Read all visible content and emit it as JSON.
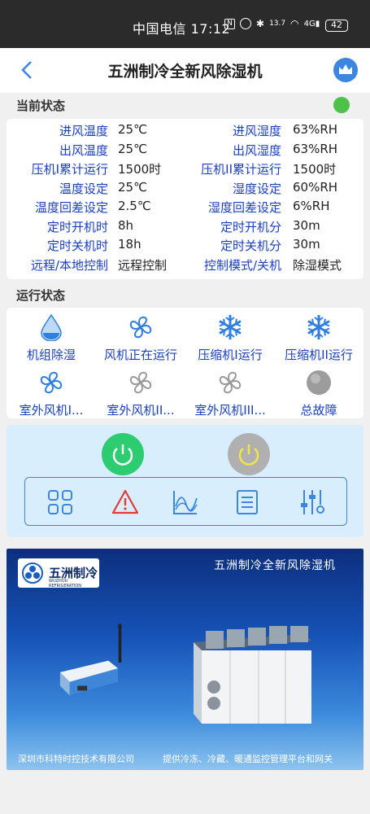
{
  "statusbar": {
    "text": "中国电信 17:12",
    "battery": "42",
    "netspeed": "13.7"
  },
  "header": {
    "title": "五洲制冷全新风除湿机"
  },
  "current_state": {
    "title": "当前状态",
    "rows": [
      {
        "l1": "进风温度",
        "v1": "25℃",
        "l2": "进风湿度",
        "v2": "63%RH"
      },
      {
        "l1": "出风温度",
        "v1": "25℃",
        "l2": "出风湿度",
        "v2": "63%RH"
      },
      {
        "l1": "压机I累计运行",
        "v1": "1500时",
        "l2": "压机II累计运行",
        "v2": "1500时"
      },
      {
        "l1": "温度设定",
        "v1": "25℃",
        "l2": "湿度设定",
        "v2": "60%RH"
      },
      {
        "l1": "温度回差设定",
        "v1": "2.5℃",
        "l2": "湿度回差设定",
        "v2": "6%RH"
      },
      {
        "l1": "定时开机时",
        "v1": "8h",
        "l2": "定时开机分",
        "v2": "30m"
      },
      {
        "l1": "定时关机时",
        "v1": "18h",
        "l2": "定时关机分",
        "v2": "30m"
      },
      {
        "l1": "远程/本地控制",
        "v1": "远程控制",
        "l2": "控制模式/关机",
        "v2": "除湿模式"
      }
    ]
  },
  "run_state": {
    "title": "运行状态",
    "items": [
      {
        "label": "机组除湿",
        "icon": "water-drop-icon"
      },
      {
        "label": "风机正在运行",
        "icon": "fan-icon"
      },
      {
        "label": "压缩机I运行",
        "icon": "snowflake-icon"
      },
      {
        "label": "压缩机II运行",
        "icon": "snowflake-icon"
      },
      {
        "label": "室外风机I...",
        "icon": "fan-icon"
      },
      {
        "label": "室外风机II...",
        "icon": "fan-icon"
      },
      {
        "label": "室外风机III...",
        "icon": "fan-icon"
      },
      {
        "label": "总故障",
        "icon": "fault-indicator-icon"
      }
    ]
  },
  "banner": {
    "logo": "五洲制冷",
    "logo_sub": "WUZHOU REFRIGERATION",
    "title": "五洲制冷全新风除湿机",
    "footer_left": "深圳市科特时控技术有限公司",
    "footer_right": "提供冷冻、冷藏、暖通监控管理平台和网关"
  },
  "colors": {
    "label": "#1a3fbf",
    "on": "#2ecc71",
    "off": "#b0b0b0",
    "status_ok": "#4cc24a"
  }
}
